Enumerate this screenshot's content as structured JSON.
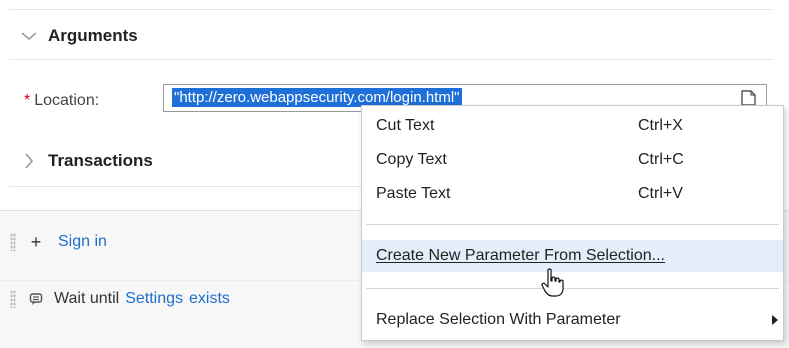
{
  "arguments": {
    "title": "Arguments",
    "location_required_mark": "*",
    "location_label": "Location:",
    "location_value": "\"http://zero.webappsecurity.com/login.html\""
  },
  "transactions": {
    "title": "Transactions"
  },
  "steps": [
    {
      "prefix": "+",
      "link": "Sign in"
    },
    {
      "prefix": "Wait until",
      "link_1": "Settings",
      "link_2": "exists"
    }
  ],
  "context_menu": {
    "items": [
      {
        "label": "Cut Text",
        "shortcut": "Ctrl+X"
      },
      {
        "label": "Copy Text",
        "shortcut": "Ctrl+C"
      },
      {
        "label": "Paste Text",
        "shortcut": "Ctrl+V"
      },
      {
        "label": "Create New Parameter From Selection...",
        "shortcut": ""
      },
      {
        "label": "Replace Selection With Parameter",
        "shortcut": ""
      }
    ]
  },
  "colors": {
    "selection": "#1f6fd8",
    "link": "#1e6fc9",
    "required": "#d0021b",
    "menu_highlight": "#e4eefb"
  },
  "icons": [
    "chevron-down-icon",
    "chevron-right-icon",
    "document-icon",
    "drag-grip-icon",
    "plus-icon",
    "wait-icon",
    "submenu-arrow-icon",
    "hand-cursor-icon"
  ]
}
